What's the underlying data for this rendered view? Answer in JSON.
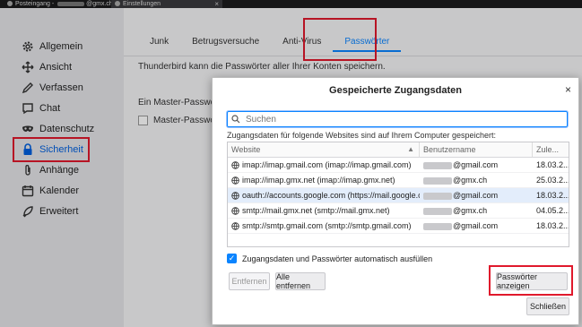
{
  "window_tabs": {
    "tab1_label_prefix": "Posteingang - ",
    "tab1_label_suffix": "@gmx.ch",
    "tab2_label": "Einstellungen",
    "tab2_close": "×"
  },
  "sidebar": {
    "items": [
      {
        "label": "Allgemein",
        "icon": "gear-icon"
      },
      {
        "label": "Ansicht",
        "icon": "move-icon"
      },
      {
        "label": "Verfassen",
        "icon": "pencil-icon"
      },
      {
        "label": "Chat",
        "icon": "chat-icon"
      },
      {
        "label": "Datenschutz",
        "icon": "mask-icon"
      },
      {
        "label": "Sicherheit",
        "icon": "lock-icon",
        "active": true
      },
      {
        "label": "Anhänge",
        "icon": "paperclip-icon"
      },
      {
        "label": "Kalender",
        "icon": "calendar-icon"
      },
      {
        "label": "Erweitert",
        "icon": "rocket-icon"
      }
    ]
  },
  "main": {
    "tabs": [
      {
        "label": "Junk"
      },
      {
        "label": "Betrugsversuche"
      },
      {
        "label": "Anti-Virus"
      },
      {
        "label": "Passwörter",
        "selected": true
      }
    ],
    "description": "Thunderbird kann die Passwörter aller Ihrer Konten speichern.",
    "master_password_text": "Ein Master-Passwort s",
    "master_password_checkbox": "Master-Passwort"
  },
  "dialog": {
    "title": "Gespeicherte Zugangsdaten",
    "close": "×",
    "search_placeholder": "Suchen",
    "info": "Zugangsdaten für folgende Websites sind auf Ihrem Computer gespeichert:",
    "columns": {
      "site": "Website",
      "user": "Benutzername",
      "date": "Zule..."
    },
    "rows": [
      {
        "site": "imap://imap.gmail.com (imap://imap.gmail.com)",
        "user": "@gmail.com",
        "date": "18.03.2..."
      },
      {
        "site": "imap://imap.gmx.net (imap://imap.gmx.net)",
        "user": "@gmx.ch",
        "date": "25.03.2..."
      },
      {
        "site": "oauth://accounts.google.com (https://mail.google.com/)",
        "user": "@gmail.com",
        "date": "18.03.2...",
        "selected": true
      },
      {
        "site": "smtp://mail.gmx.net (smtp://mail.gmx.net)",
        "user": "@gmx.ch",
        "date": "04.05.2..."
      },
      {
        "site": "smtp://smtp.gmail.com (smtp://smtp.gmail.com)",
        "user": "@gmail.com",
        "date": "18.03.2..."
      }
    ],
    "autofill_label": "Zugangsdaten und Passwörter automatisch ausfüllen",
    "autofill_checked": true,
    "btn_remove": "Entfernen",
    "btn_remove_all": "Alle entfernen",
    "btn_show_passwords": "Passwörter anzeigen",
    "btn_close": "Schließen"
  },
  "colors": {
    "accent": "#0a84ff",
    "highlight": "#e0192c",
    "active_nav": "#0060df"
  }
}
